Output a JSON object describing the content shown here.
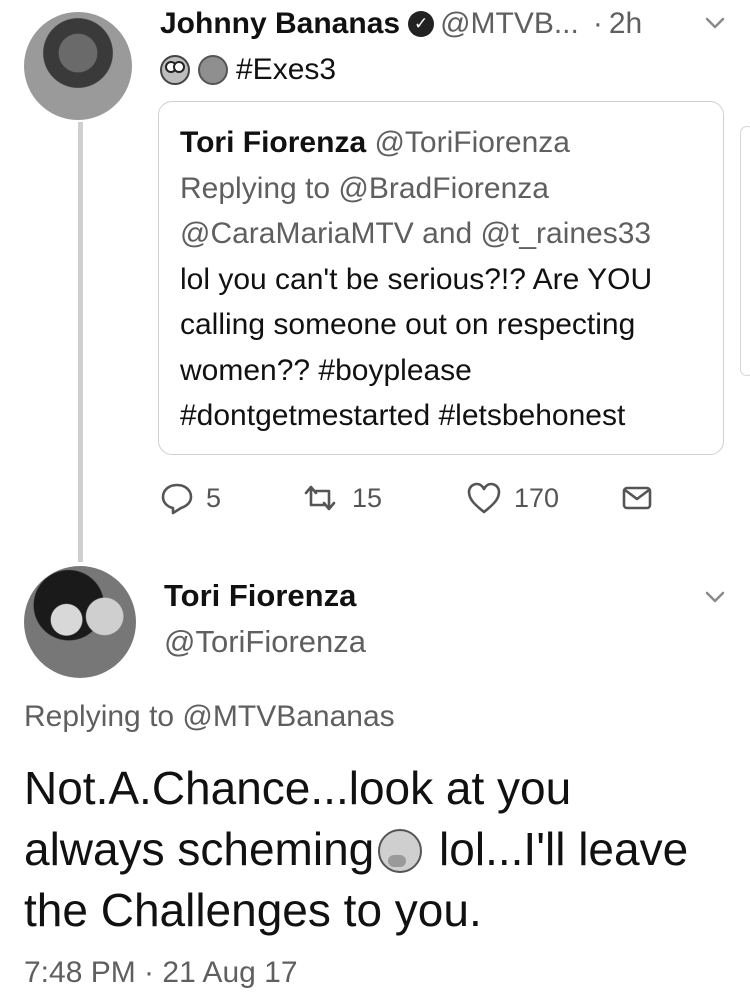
{
  "tweet1": {
    "author_name": "Johnny Bananas",
    "handle": "@MTVB...",
    "separator": "·",
    "time": "2h",
    "hashtag": "#Exes3",
    "emoji": [
      "frog-face-icon",
      "coffee-cup-icon"
    ]
  },
  "quote": {
    "author_name": "Tori Fiorenza",
    "handle": "@ToriFiorenza",
    "replying_line1": "Replying to @BradFiorenza",
    "replying_line2": "@CaraMariaMTV and @t_raines33",
    "text_lines": [
      "lol you can't be serious?!? Are YOU",
      "calling someone out on respecting",
      "women?? #boyplease",
      "#dontgetmestarted #letsbehonest"
    ]
  },
  "actions": {
    "reply_count": "5",
    "retweet_count": "15",
    "like_count": "170"
  },
  "tweet2": {
    "author_name": "Tori Fiorenza",
    "handle": "@ToriFiorenza",
    "replying_to": "Replying to @MTVBananas",
    "text_part1": "Not.A.Chance...look at you always scheming",
    "text_part2": " lol...I'll leave the Challenges to you.",
    "emoji": "thinking-face-icon",
    "timestamp": "7:48 PM · 21 Aug 17"
  }
}
